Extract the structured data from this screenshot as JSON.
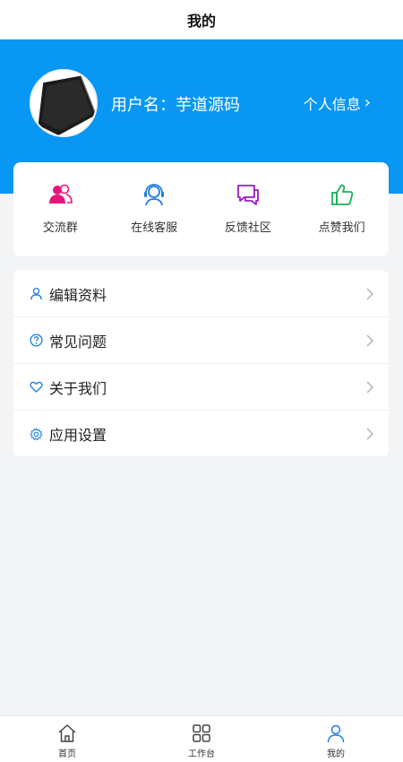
{
  "header": {
    "title": "我的"
  },
  "profile": {
    "username": "用户名：芋道源码",
    "link_label": "个人信息",
    "link_chevron": "›"
  },
  "quick_actions": [
    {
      "label": "交流群",
      "icon": "group-icon",
      "color": "#e8147e"
    },
    {
      "label": "在线客服",
      "icon": "customer-service-icon",
      "color": "#1e7fe0"
    },
    {
      "label": "反馈社区",
      "icon": "chat-bubbles-icon",
      "color": "#9b1ac7"
    },
    {
      "label": "点赞我们",
      "icon": "thumbs-up-icon",
      "color": "#18b35a"
    }
  ],
  "menu": [
    {
      "label": "编辑资料",
      "icon": "user-icon"
    },
    {
      "label": "常见问题",
      "icon": "question-circle-icon"
    },
    {
      "label": "关于我们",
      "icon": "heart-icon"
    },
    {
      "label": "应用设置",
      "icon": "gear-icon"
    }
  ],
  "tabbar": [
    {
      "label": "首页",
      "icon": "home-icon",
      "active": false
    },
    {
      "label": "工作台",
      "icon": "grid-icon",
      "active": false
    },
    {
      "label": "我的",
      "icon": "user-icon",
      "active": true
    }
  ],
  "colors": {
    "hero_bg": "#0897f3",
    "accent": "#1e7fe0",
    "page_bg": "#f3f4f6"
  }
}
